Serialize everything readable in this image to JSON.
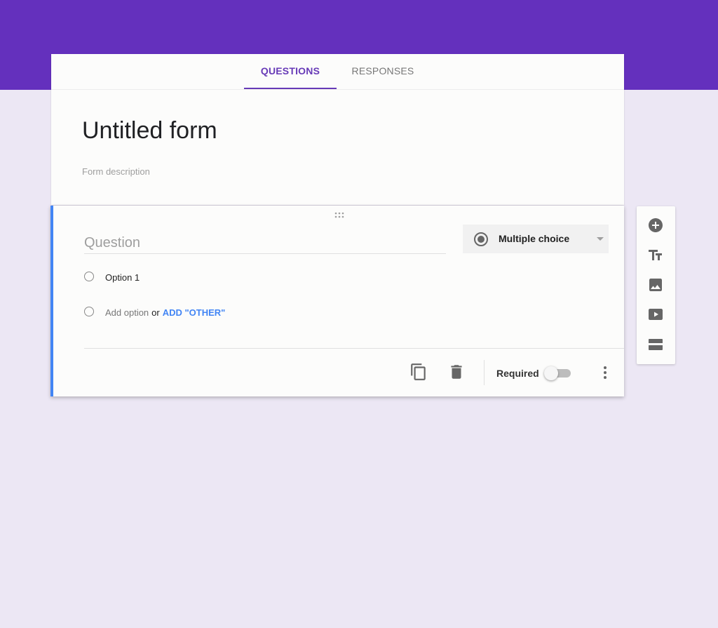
{
  "colors": {
    "brand": "#673ab7",
    "accent_blue": "#4285f4",
    "band": "#6430bd",
    "page_bg": "#ece7f4"
  },
  "tabs": [
    {
      "label": "QUESTIONS",
      "active": true
    },
    {
      "label": "RESPONSES",
      "active": false
    }
  ],
  "form": {
    "title": "Untitled form",
    "description_placeholder": "Form description"
  },
  "question": {
    "placeholder": "Question",
    "type": {
      "label": "Multiple choice",
      "icon": "radio-checked-icon"
    },
    "options": [
      {
        "label": "Option 1"
      }
    ],
    "add_option": {
      "label": "Add option",
      "or": "or",
      "add_other": "ADD \"OTHER\""
    },
    "footer": {
      "copy_icon": "content-copy-icon",
      "delete_icon": "trash-icon",
      "required_label": "Required",
      "required_on": false,
      "more_icon": "more-vert-icon"
    }
  },
  "side_toolbar": [
    {
      "icon": "add-circle-icon"
    },
    {
      "icon": "title-text-icon"
    },
    {
      "icon": "image-icon"
    },
    {
      "icon": "video-icon"
    },
    {
      "icon": "section-icon"
    }
  ]
}
